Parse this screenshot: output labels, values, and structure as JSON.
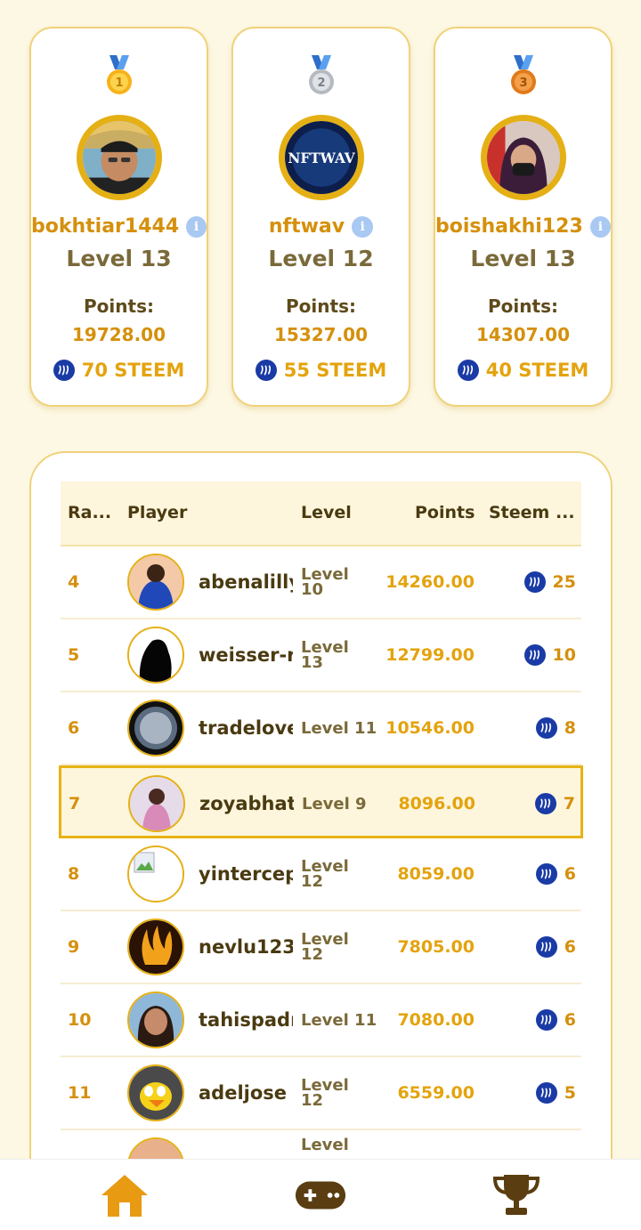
{
  "podium": [
    {
      "place": 1,
      "medal_icon": "medal-first-icon",
      "name": "bokhtiar1444",
      "level": "Level 13",
      "points_label": "Points:",
      "points": "19728.00",
      "reward": "70 STEEM"
    },
    {
      "place": 2,
      "medal_icon": "medal-second-icon",
      "name": "nftwav",
      "level": "Level 12",
      "points_label": "Points:",
      "points": "15327.00",
      "reward": "55 STEEM"
    },
    {
      "place": 3,
      "medal_icon": "medal-third-icon",
      "name": "boishakhi123",
      "level": "Level 13",
      "points_label": "Points:",
      "points": "14307.00",
      "reward": "40 STEEM"
    }
  ],
  "table": {
    "headers": {
      "rank": "Ra...",
      "player": "Player",
      "level": "Level",
      "points": "Points",
      "steem": "Steem ..."
    },
    "rows": [
      {
        "rank": "4",
        "name": "abenalilly",
        "level_1": "Level",
        "level_2": "10",
        "points": "14260.00",
        "steem": "25"
      },
      {
        "rank": "5",
        "name": "weisser-r",
        "level_1": "Level",
        "level_2": "13",
        "points": "12799.00",
        "steem": "10"
      },
      {
        "rank": "6",
        "name": "tradelove",
        "level_1": "Level 11",
        "level_2": "",
        "points": "10546.00",
        "steem": "8"
      },
      {
        "rank": "7",
        "name": "zoyabhat",
        "level_1": "Level 9",
        "level_2": "",
        "points": "8096.00",
        "steem": "7"
      },
      {
        "rank": "8",
        "name": "yintercep",
        "level_1": "Level",
        "level_2": "12",
        "points": "8059.00",
        "steem": "6"
      },
      {
        "rank": "9",
        "name": "nevlu123",
        "level_1": "Level",
        "level_2": "12",
        "points": "7805.00",
        "steem": "6"
      },
      {
        "rank": "10",
        "name": "tahispadr",
        "level_1": "Level 11",
        "level_2": "",
        "points": "7080.00",
        "steem": "6"
      },
      {
        "rank": "11",
        "name": "adeljose",
        "level_1": "Level",
        "level_2": "12",
        "points": "6559.00",
        "steem": "5"
      },
      {
        "rank": "",
        "name": "",
        "level_1": "Level",
        "level_2": "",
        "points": "",
        "steem": ""
      }
    ],
    "highlighted_rank": "7"
  },
  "nav": {
    "items": [
      "home-icon",
      "gamepad-icon",
      "trophy-icon"
    ],
    "active": "home-icon"
  },
  "colors": {
    "accent": "#d5900c",
    "gold": "#e5b015",
    "background": "#fdf8e4",
    "steem": "#1a3ba6",
    "nav_dark": "#5a3d10"
  }
}
